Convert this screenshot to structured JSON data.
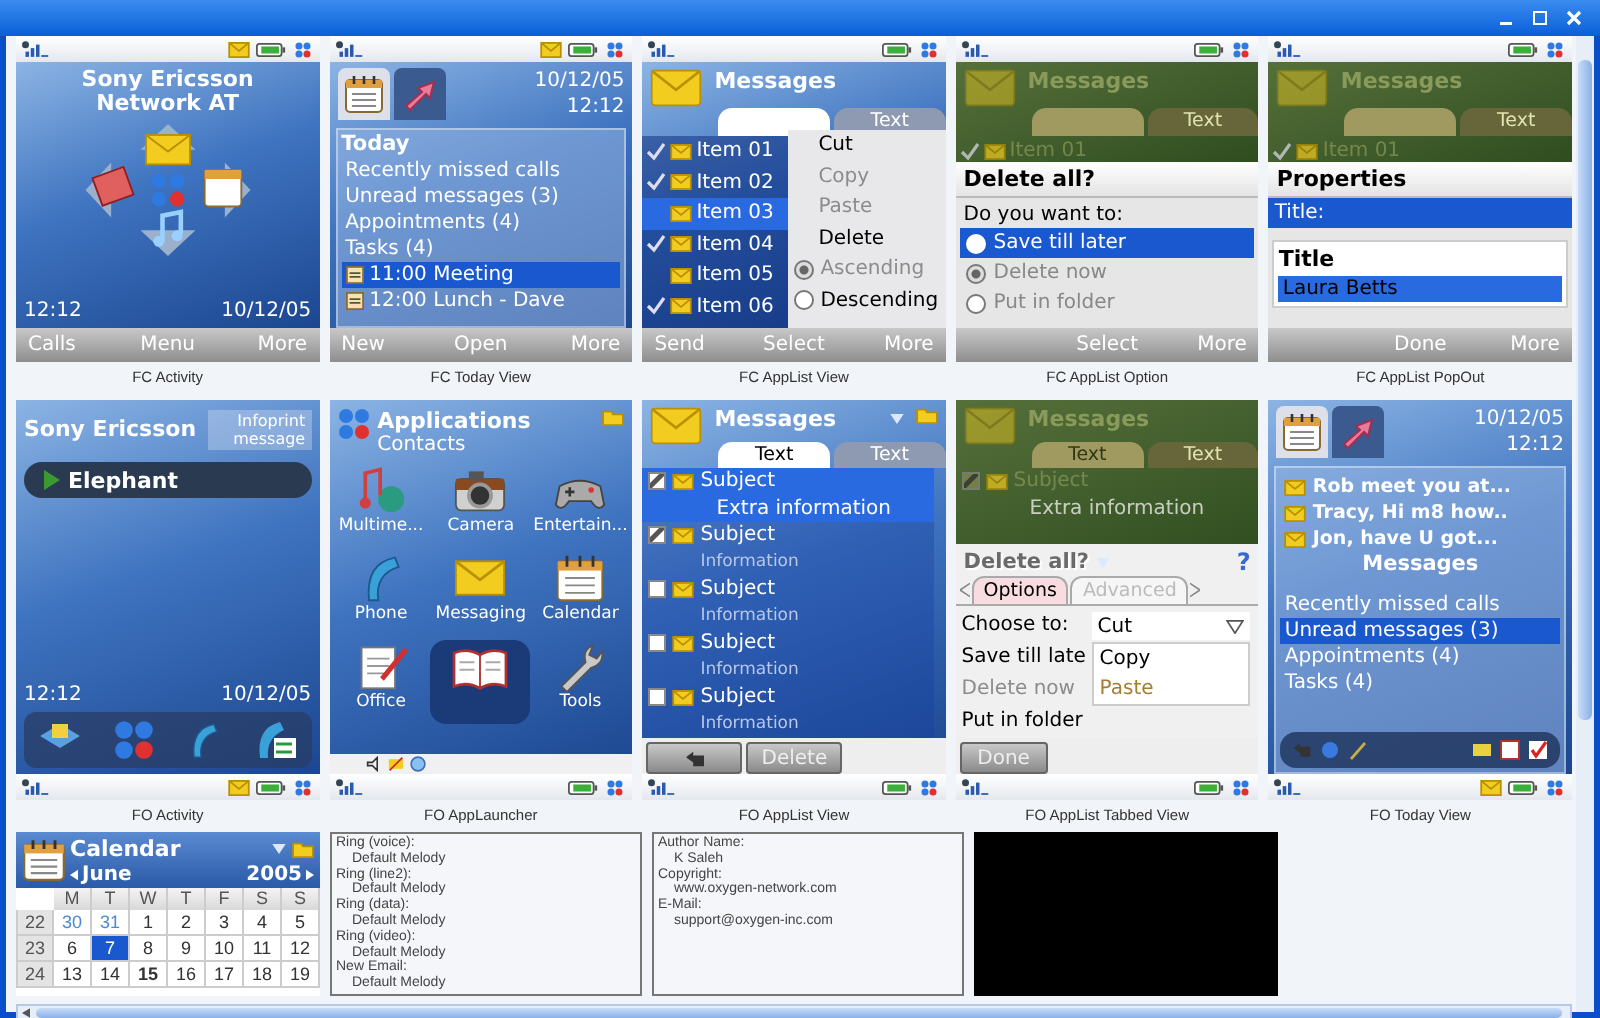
{
  "panels": [
    {
      "kind": "standby",
      "caption": "FC Activity",
      "new_message": true,
      "operator": [
        "Sony Ericsson",
        "Network AT"
      ],
      "time": "12:12",
      "date": "10/12/05",
      "softkeys": {
        "left": "Calls",
        "center": "Menu",
        "right": "More"
      }
    },
    {
      "kind": "today",
      "caption": "FC Today View",
      "new_message": true,
      "date": "10/12/05",
      "time": "12:12",
      "heading": "Today",
      "items": [
        {
          "kind": "text",
          "label": "Recently missed calls",
          "selected": false
        },
        {
          "kind": "text",
          "label": "Unread messages (3)",
          "selected": false
        },
        {
          "kind": "text",
          "label": "Appointments (4)",
          "selected": false
        },
        {
          "kind": "text",
          "label": "Tasks (4)",
          "selected": false
        },
        {
          "kind": "appointment",
          "label": "11:00 Meeting",
          "selected": true
        },
        {
          "kind": "appointment",
          "label": "12:00 Lunch - Dave",
          "selected": false
        }
      ],
      "softkeys": {
        "left": "New",
        "center": "Open",
        "right": "More"
      }
    },
    {
      "kind": "applist",
      "caption": "FC AppList View",
      "new_message": false,
      "title": "Messages",
      "tabs": [
        {
          "selected": true
        },
        {
          "label": "Text",
          "selected": false
        }
      ],
      "items": [
        {
          "label": "Item 01",
          "checked": true,
          "selected": false
        },
        {
          "label": "Item 02",
          "checked": true,
          "selected": false
        },
        {
          "label": "Item 03",
          "checked": false,
          "selected": true
        },
        {
          "label": "Item 04",
          "checked": true,
          "selected": false
        },
        {
          "label": "Item 05",
          "checked": false,
          "selected": false
        },
        {
          "label": "Item 06",
          "checked": true,
          "selected": false
        }
      ],
      "menu": [
        {
          "kind": "action",
          "label": "Cut",
          "disabled": false
        },
        {
          "kind": "action",
          "label": "Copy",
          "disabled": true
        },
        {
          "kind": "action",
          "label": "Paste",
          "disabled": true
        },
        {
          "kind": "action",
          "label": "Delete",
          "disabled": false
        },
        {
          "kind": "radio",
          "label": "Ascending",
          "disabled": true,
          "selected": true
        },
        {
          "kind": "radio",
          "label": "Descending",
          "disabled": false,
          "selected": false
        }
      ],
      "softkeys": {
        "left": "Send",
        "center": "Select",
        "right": "More"
      }
    },
    {
      "kind": "option",
      "caption": "FC AppList Option",
      "new_message": false,
      "background": {
        "title": "Messages",
        "tabs": [
          {
            "selected": true
          },
          {
            "label": "Text",
            "selected": false
          }
        ],
        "item": {
          "label": "Item 01",
          "checked": true
        }
      },
      "dialog": {
        "title": "Delete all?",
        "prompt": "Do you want to:",
        "options": [
          {
            "label": "Save till later",
            "highlighted": true,
            "selected": false,
            "disabled": false
          },
          {
            "label": "Delete now",
            "highlighted": false,
            "selected": true,
            "disabled": true
          },
          {
            "label": "Put in folder",
            "highlighted": false,
            "selected": false,
            "disabled": true
          }
        ]
      },
      "softkeys": {
        "center": "Select",
        "right": "More"
      }
    },
    {
      "kind": "popout",
      "caption": "FC AppList PopOut",
      "new_message": false,
      "background": {
        "title": "Messages",
        "tabs": [
          {
            "selected": true
          },
          {
            "label": "Text",
            "selected": false
          }
        ],
        "item": {
          "label": "Item 01",
          "checked": true
        }
      },
      "dialog": {
        "title": "Properties",
        "fields": [
          {
            "label": "Title:",
            "selected": true
          }
        ]
      },
      "popout": {
        "label": "Title",
        "value": "Laura Betts"
      },
      "softkeys": {
        "center": "Done",
        "right": "More"
      }
    },
    {
      "kind": "standby_full",
      "caption": "FO Activity",
      "new_message": true,
      "operator": "Sony Ericsson",
      "infoprint": "Infoprint message",
      "now_playing": "Elephant",
      "time": "12:12",
      "date": "10/12/05"
    },
    {
      "kind": "launcher",
      "caption": "FO AppLauncher",
      "new_message": false,
      "title": "Applications",
      "subtitle": "Contacts",
      "apps": [
        {
          "label": "Multime...",
          "selected": false
        },
        {
          "label": "Camera",
          "selected": false
        },
        {
          "label": "Entertain...",
          "selected": false
        },
        {
          "label": "Phone",
          "selected": false
        },
        {
          "label": "Messaging",
          "selected": false
        },
        {
          "label": "Calendar",
          "selected": false
        },
        {
          "label": "Office",
          "selected": false
        },
        {
          "selected": true
        },
        {
          "label": "Tools",
          "selected": false
        }
      ]
    },
    {
      "kind": "applist_view",
      "caption": "FO AppList View",
      "new_message": false,
      "title": "Messages",
      "tabs": [
        {
          "label": "Text",
          "selected": true
        },
        {
          "label": "Text",
          "selected": false
        }
      ],
      "items": [
        {
          "subject": "Subject",
          "info": "Extra information",
          "checked": true,
          "selected": true
        },
        {
          "subject": "Subject",
          "info": "Information",
          "checked": true,
          "selected": false
        },
        {
          "subject": "Subject",
          "info": "Information",
          "checked": false,
          "selected": false
        },
        {
          "subject": "Subject",
          "info": "Information",
          "checked": false,
          "selected": false
        },
        {
          "subject": "Subject",
          "info": "Information",
          "checked": false,
          "selected": false
        }
      ],
      "buttons": [
        {
          "kind": "back"
        },
        {
          "kind": "text",
          "label": "Delete"
        }
      ]
    },
    {
      "kind": "tabbed",
      "caption": "FO AppList Tabbed View",
      "new_message": false,
      "background": {
        "title": "Messages",
        "tabs": [
          {
            "label": "Text",
            "selected": true
          },
          {
            "label": "Text",
            "selected": false
          }
        ],
        "items": [
          {
            "subject": "Subject",
            "info": "Extra information",
            "checked": true
          }
        ]
      },
      "dialog": {
        "title": "Delete all?",
        "help": "?",
        "tabs": [
          {
            "label": "Options",
            "selected": true
          },
          {
            "label": "Advanced",
            "selected": false
          }
        ],
        "rows": [
          {
            "label": "Choose to:",
            "disabled": false
          },
          {
            "label": "Save till late",
            "disabled": false
          },
          {
            "label": "Delete now",
            "disabled": true
          },
          {
            "label": "Put in folder",
            "disabled": false
          }
        ],
        "dropdown": {
          "value": "Cut",
          "options": [
            {
              "label": "Copy",
              "disabled": false
            },
            {
              "label": "Paste",
              "disabled": true
            }
          ]
        },
        "button": "Done"
      }
    },
    {
      "kind": "today_full",
      "caption": "FO Today View",
      "new_message": true,
      "date": "10/12/05",
      "time": "12:12",
      "messages": [
        "Rob meet you at...",
        "Tracy, Hi m8 how..",
        "Jon, have U got..."
      ],
      "heading": "Messages",
      "items": [
        {
          "label": "Recently missed calls",
          "selected": false
        },
        {
          "label": "Unread messages (3)",
          "selected": true
        },
        {
          "label": "Appointments (4)",
          "selected": false
        },
        {
          "label": "Tasks (4)",
          "selected": false
        }
      ]
    }
  ],
  "calendar": {
    "title": "Calendar",
    "month": "June",
    "year": "2005",
    "weekdays": [
      "M",
      "T",
      "W",
      "T",
      "F",
      "S",
      "S"
    ],
    "weeks": [
      {
        "number": "22",
        "days": [
          {
            "label": "30",
            "muted": true,
            "selected": false,
            "today": false
          },
          {
            "label": "31",
            "muted": true,
            "selected": false,
            "today": false
          },
          {
            "label": "1",
            "muted": false,
            "selected": false,
            "today": false
          },
          {
            "label": "2",
            "muted": false,
            "selected": false,
            "today": false
          },
          {
            "label": "3",
            "muted": false,
            "selected": false,
            "today": false
          },
          {
            "label": "4",
            "muted": false,
            "selected": false,
            "today": false
          },
          {
            "label": "5",
            "muted": false,
            "selected": false,
            "today": false
          }
        ]
      },
      {
        "number": "23",
        "days": [
          {
            "label": "6",
            "muted": false,
            "selected": false,
            "today": false
          },
          {
            "label": "7",
            "muted": false,
            "selected": true,
            "today": false
          },
          {
            "label": "8",
            "muted": false,
            "selected": false,
            "today": false
          },
          {
            "label": "9",
            "muted": false,
            "selected": false,
            "today": false
          },
          {
            "label": "10",
            "muted": false,
            "selected": false,
            "today": false
          },
          {
            "label": "11",
            "muted": false,
            "selected": false,
            "today": false
          },
          {
            "label": "12",
            "muted": false,
            "selected": false,
            "today": false
          }
        ]
      },
      {
        "number": "24",
        "days": [
          {
            "label": "13",
            "muted": false,
            "selected": false,
            "today": false
          },
          {
            "label": "14",
            "muted": false,
            "selected": false,
            "today": false
          },
          {
            "label": "15",
            "muted": false,
            "selected": false,
            "today": true
          },
          {
            "label": "16",
            "muted": false,
            "selected": false,
            "today": false
          },
          {
            "label": "17",
            "muted": false,
            "selected": false,
            "today": false
          },
          {
            "label": "18",
            "muted": false,
            "selected": false,
            "today": false
          },
          {
            "label": "19",
            "muted": false,
            "selected": false,
            "today": false
          }
        ]
      }
    ]
  },
  "ring_settings": [
    {
      "label": "Ring (voice):",
      "value": "Default Melody"
    },
    {
      "label": "Ring (line2):",
      "value": "Default Melody"
    },
    {
      "label": "Ring (data):",
      "value": "Default Melody"
    },
    {
      "label": "Ring (video):",
      "value": "Default Melody"
    },
    {
      "label": "New Email:",
      "value": "Default Melody"
    }
  ],
  "author_info": [
    {
      "label": "Author Name:",
      "value": "K Saleh"
    },
    {
      "label": "Copyright:",
      "value": "www.oxygen-network.com"
    },
    {
      "label": "E-Mail:",
      "value": "support@oxygen-inc.com"
    }
  ]
}
